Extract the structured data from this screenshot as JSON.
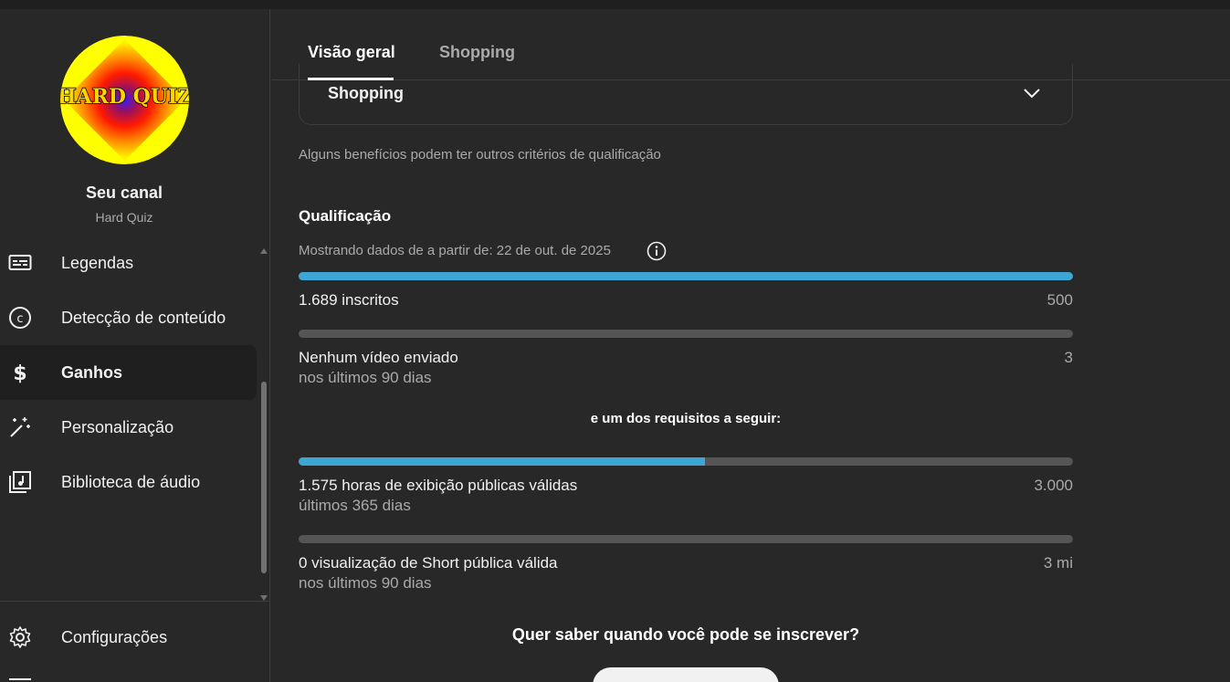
{
  "channel": {
    "title": "Seu canal",
    "name": "Hard Quiz",
    "avatar_text": "HARD QUIZ"
  },
  "sidebar": {
    "items": [
      {
        "label": "Legendas",
        "icon": "subtitles-icon",
        "active": false
      },
      {
        "label": "Detecção de conteúdo",
        "icon": "copyright-icon",
        "active": false
      },
      {
        "label": "Ganhos",
        "icon": "dollar-icon",
        "active": true
      },
      {
        "label": "Personalização",
        "icon": "magic-wand-icon",
        "active": false
      },
      {
        "label": "Biblioteca de áudio",
        "icon": "audio-library-icon",
        "active": false
      }
    ],
    "settings": {
      "label": "Configurações",
      "icon": "gear-icon"
    }
  },
  "tabs": [
    {
      "label": "Visão geral",
      "active": true
    },
    {
      "label": "Shopping",
      "active": false
    }
  ],
  "benefits_card": {
    "label": "Shopping"
  },
  "note": "Alguns benefícios podem ter outros critérios de qualificação",
  "qualification": {
    "title": "Qualificação",
    "data_since": "Mostrando dados de a partir de: 22 de out. de 2025",
    "metrics": [
      {
        "label": "1.689 inscritos",
        "sub": "",
        "target": "500",
        "progress": 1.0
      },
      {
        "label": "Nenhum vídeo enviado",
        "sub": "nos últimos 90 dias",
        "target": "3",
        "progress": 0.0
      }
    ],
    "or_label": "e um dos requisitos a seguir:",
    "alt_metrics": [
      {
        "label": "1.575 horas de exibição públicas válidas",
        "sub": "últimos 365 dias",
        "target": "3.000",
        "progress": 0.525
      },
      {
        "label": "0 visualização de Short pública válida",
        "sub": "nos últimos 90 dias",
        "target": "3 mi",
        "progress": 0.0
      }
    ]
  },
  "question": "Quer saber quando você pode se inscrever?",
  "notify_button": "",
  "colors": {
    "background": "#282828",
    "accent": "#3ea6d4",
    "track": "#555555",
    "muted_text": "#aaaaaa"
  }
}
